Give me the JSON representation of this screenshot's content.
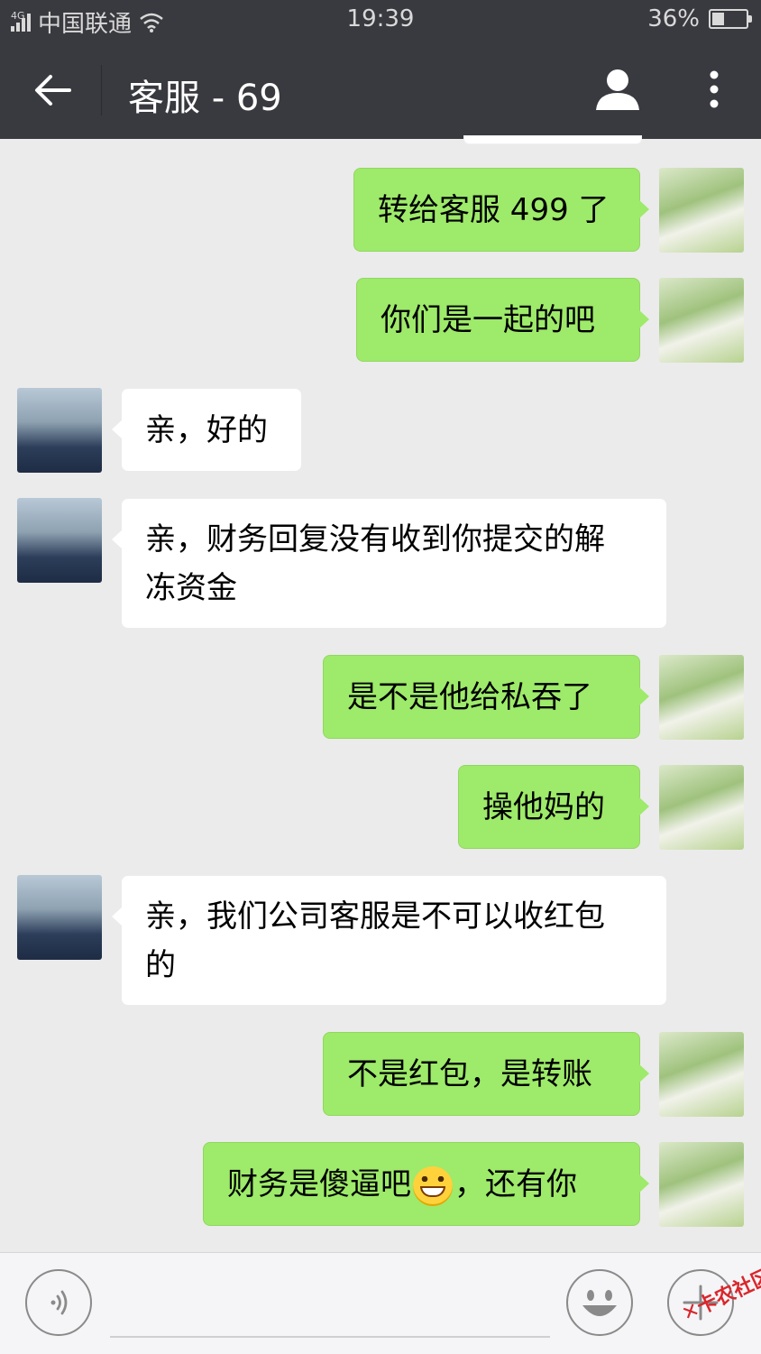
{
  "status_bar": {
    "network": "4G",
    "carrier": "中国联通",
    "time": "19:39",
    "battery": "36%",
    "battery_level": 0.36
  },
  "header": {
    "title": "客服 - 69"
  },
  "messages": [
    {
      "from": "me",
      "text": "转给客服 499 了"
    },
    {
      "from": "me",
      "text": "你们是一起的吧"
    },
    {
      "from": "kf",
      "text": "亲，好的"
    },
    {
      "from": "kf",
      "line1": "亲，财务回复没有收到你提交的解",
      "line2": "冻资金"
    },
    {
      "from": "me",
      "text": "是不是他给私吞了"
    },
    {
      "from": "me",
      "text": "操他妈的"
    },
    {
      "from": "kf",
      "line1": "亲，我们公司客服是不可以收红包",
      "line2": "的"
    },
    {
      "from": "me",
      "text": "不是红包，是转账"
    },
    {
      "from": "me",
      "before_emoji": "财务是傻逼吧",
      "emoji": "grinning-face-emoji",
      "after_emoji": "，还有你"
    }
  ],
  "watermark": "卡农社区"
}
